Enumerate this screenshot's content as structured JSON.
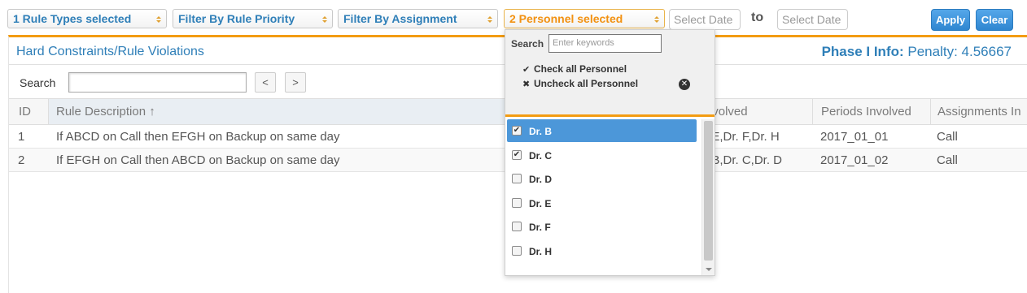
{
  "filters": {
    "rule_types": "1 Rule Types selected",
    "rule_priority": "Filter By Rule Priority",
    "assignment": "Filter By Assignment",
    "personnel": "2 Personnel selected",
    "date_from_placeholder": "Select Date",
    "to_label": "to",
    "date_to_placeholder": "Select Date",
    "apply_label": "Apply",
    "clear_label": "Clear"
  },
  "panel": {
    "title": "Hard Constraints/Rule Violations",
    "phase_label": "Phase I Info:",
    "phase_value": "Penalty: 4.56667",
    "search_label": "Search",
    "prev_label": "<",
    "next_label": ">"
  },
  "table": {
    "columns": [
      "ID",
      "Rule Description",
      "Personnel Involved",
      "Periods Involved",
      "Assignments In"
    ],
    "sort_indicator": "↑",
    "rows": [
      {
        "id": "1",
        "description": "If ABCD on Call then EFGH on Backup on same day",
        "personnel": ". E,Dr. F,Dr. H",
        "periods": "2017_01_01",
        "assignments": "Call"
      },
      {
        "id": "2",
        "description": "If EFGH on Call then ABCD on Backup on same day",
        "personnel": ". B,Dr. C,Dr. D",
        "periods": "2017_01_02",
        "assignments": "Call"
      }
    ]
  },
  "dropdown": {
    "search_label": "Search",
    "search_placeholder": "Enter keywords",
    "check_all": "Check all Personnel",
    "uncheck_all": "Uncheck all Personnel",
    "items": [
      {
        "label": "Dr. B",
        "checked": true,
        "highlighted": true
      },
      {
        "label": "Dr. C",
        "checked": true,
        "highlighted": false
      },
      {
        "label": "Dr. D",
        "checked": false,
        "highlighted": false
      },
      {
        "label": "Dr. E",
        "checked": false,
        "highlighted": false
      },
      {
        "label": "Dr. F",
        "checked": false,
        "highlighted": false
      },
      {
        "label": "Dr. H",
        "checked": false,
        "highlighted": false
      }
    ]
  },
  "colors": {
    "accent_blue": "#2f7fb8",
    "accent_orange": "#f39c12",
    "button_blue": "#2f86d0",
    "selected_item": "#4c97d9"
  }
}
